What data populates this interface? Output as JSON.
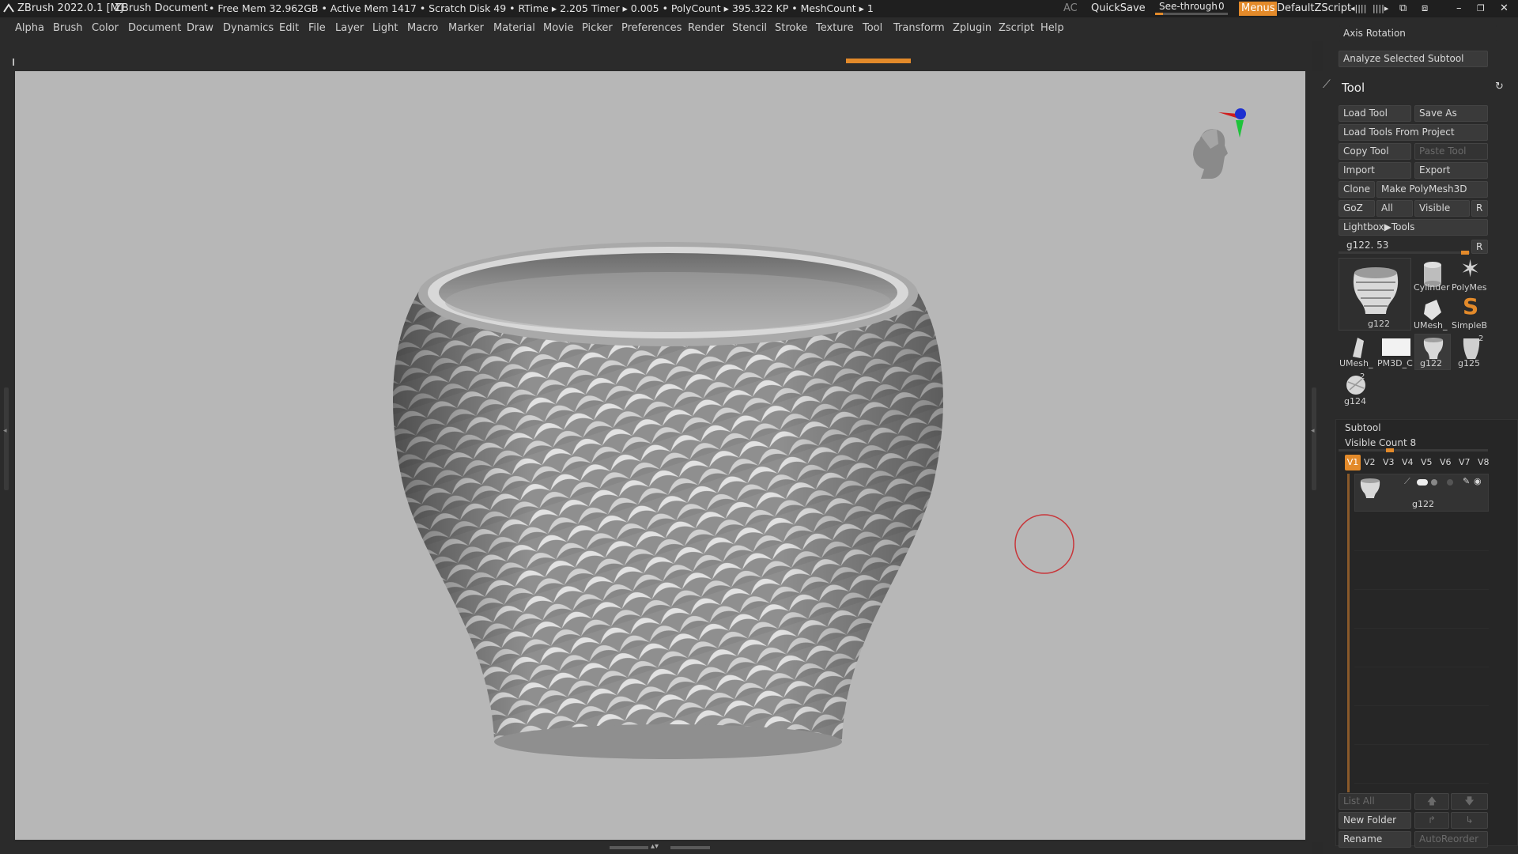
{
  "titlebar": {
    "app_title": "ZBrush 2022.0.1 [M]",
    "document": "ZBrush Document",
    "stats": "• Free Mem 32.962GB • Active Mem 1417 • Scratch Disk 49 • RTime ▸ 2.205 Timer ▸ 0.005 • PolyCount ▸ 395.322 KP • MeshCount ▸ 1",
    "ac": "AC",
    "quicksave": "QuickSave",
    "see_through_label": "See-through",
    "see_through_value": "0",
    "menus": "Menus",
    "default_zscript": "DefaultZScript"
  },
  "menubar": {
    "items": [
      "Alpha",
      "Brush",
      "Color",
      "Document",
      "Draw",
      "Dynamics",
      "Edit",
      "File",
      "Layer",
      "Light",
      "Macro",
      "Marker",
      "Material",
      "Movie",
      "Picker",
      "Preferences",
      "Render",
      "Stencil",
      "Stroke",
      "Texture",
      "Tool",
      "Transform",
      "Zplugin",
      "Zscript",
      "Help"
    ]
  },
  "panel": {
    "axis_rotation": "Axis Rotation",
    "analyze_subtool": "Analyze Selected Subtool",
    "tool_title": "Tool",
    "load_tool": "Load Tool",
    "save_as": "Save As",
    "load_tools_from_project": "Load Tools From Project",
    "copy_tool": "Copy Tool",
    "paste_tool": "Paste Tool",
    "import": "Import",
    "export": "Export",
    "clone": "Clone",
    "make_polymesh": "Make PolyMesh3D",
    "goz": "GoZ",
    "all": "All",
    "visible": "Visible",
    "r": "R",
    "lightbox_tools": "Lightbox▶Tools",
    "current_tool": "g122. 53",
    "current_tool_slider": 0.95,
    "tools": [
      {
        "label": "g122"
      },
      {
        "label": "Cylinder"
      },
      {
        "label": "PolyMes"
      },
      {
        "label": "UMesh_"
      },
      {
        "label": "SimpleB"
      },
      {
        "label": "UMesh_"
      },
      {
        "label": "PM3D_C"
      },
      {
        "label": "g122"
      },
      {
        "label": "g125"
      },
      {
        "label": "g124"
      }
    ],
    "badge_2a": "2",
    "badge_2b": "2",
    "subtool_title": "Subtool",
    "visible_count": "Visible Count 8",
    "visible_count_slider": 0.33,
    "versions": [
      "V1",
      "V2",
      "V3",
      "V4",
      "V5",
      "V6",
      "V7",
      "V8"
    ],
    "subtool_name": "g122",
    "list_all": "List All",
    "new_folder": "New Folder",
    "rename": "Rename",
    "autoreorder": "AutoReorder"
  },
  "colors": {
    "accent": "#e38a2a",
    "viewport_bg": "#b7b7b7",
    "brush_cursor": "#c8363a"
  }
}
